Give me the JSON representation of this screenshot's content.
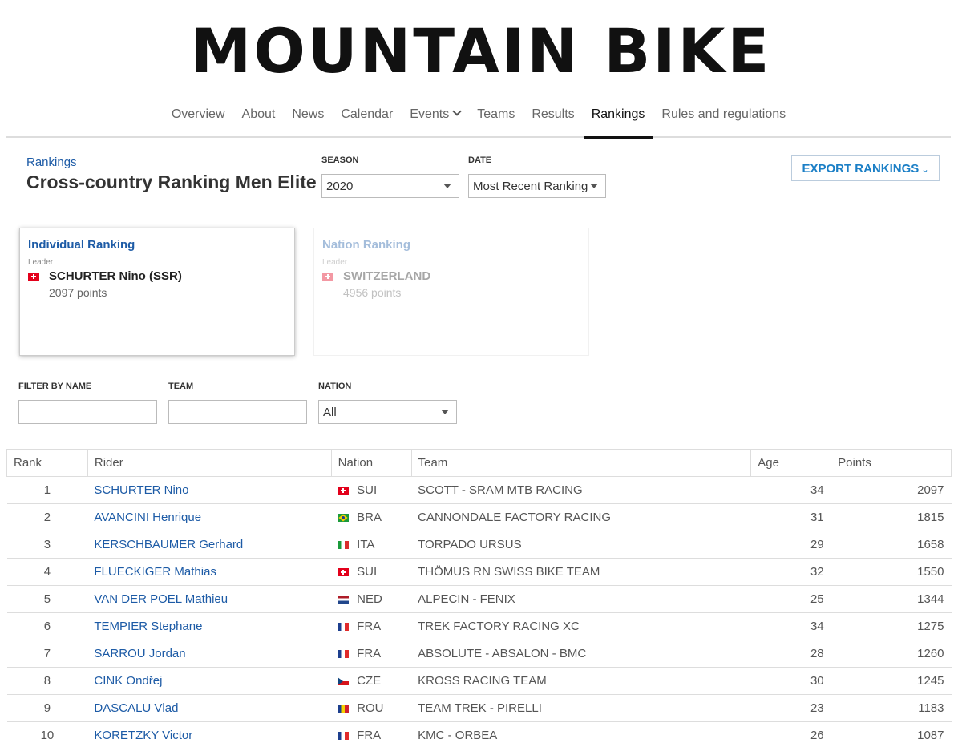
{
  "site": {
    "title": "MOUNTAIN BIKE"
  },
  "nav": {
    "items": [
      {
        "label": "Overview"
      },
      {
        "label": "About"
      },
      {
        "label": "News"
      },
      {
        "label": "Calendar"
      },
      {
        "label": "Events"
      },
      {
        "label": "Teams"
      },
      {
        "label": "Results"
      },
      {
        "label": "Rankings"
      },
      {
        "label": "Rules and regulations"
      }
    ],
    "active": "Rankings"
  },
  "header": {
    "breadcrumb": "Rankings",
    "title": "Cross-country Ranking Men Elite",
    "season_label": "SEASON",
    "season_value": "2020",
    "date_label": "DATE",
    "date_value": "Most Recent Ranking",
    "export_label": "EXPORT RANKINGS"
  },
  "cards": {
    "individual": {
      "title": "Individual Ranking",
      "sub": "Leader",
      "leader": "SCHURTER Nino (SSR)",
      "points": "2097 points",
      "flag": "ch"
    },
    "nation": {
      "title": "Nation Ranking",
      "sub": "Leader",
      "leader": "SWITZERLAND",
      "points": "4956 points",
      "flag": "ch"
    }
  },
  "filters": {
    "name_label": "FILTER BY NAME",
    "team_label": "TEAM",
    "nation_label": "NATION",
    "nation_value": "All"
  },
  "table": {
    "headers": [
      "Rank",
      "Rider",
      "Nation",
      "Team",
      "Age",
      "Points"
    ],
    "rows": [
      {
        "rank": "1",
        "rider": "SCHURTER Nino",
        "flag": "ch",
        "nation": "SUI",
        "team": "SCOTT - SRAM MTB RACING",
        "age": "34",
        "points": "2097"
      },
      {
        "rank": "2",
        "rider": "AVANCINI Henrique",
        "flag": "br",
        "nation": "BRA",
        "team": "CANNONDALE FACTORY RACING",
        "age": "31",
        "points": "1815"
      },
      {
        "rank": "3",
        "rider": "KERSCHBAUMER Gerhard",
        "flag": "it",
        "nation": "ITA",
        "team": "TORPADO URSUS",
        "age": "29",
        "points": "1658"
      },
      {
        "rank": "4",
        "rider": "FLUECKIGER Mathias",
        "flag": "ch",
        "nation": "SUI",
        "team": "THÖMUS RN SWISS BIKE TEAM",
        "age": "32",
        "points": "1550"
      },
      {
        "rank": "5",
        "rider": "VAN DER POEL Mathieu",
        "flag": "nl",
        "nation": "NED",
        "team": "ALPECIN - FENIX",
        "age": "25",
        "points": "1344"
      },
      {
        "rank": "6",
        "rider": "TEMPIER Stephane",
        "flag": "fr",
        "nation": "FRA",
        "team": "TREK FACTORY RACING XC",
        "age": "34",
        "points": "1275"
      },
      {
        "rank": "7",
        "rider": "SARROU Jordan",
        "flag": "fr",
        "nation": "FRA",
        "team": "ABSOLUTE - ABSALON - BMC",
        "age": "28",
        "points": "1260"
      },
      {
        "rank": "8",
        "rider": "CINK Ondřej",
        "flag": "cz",
        "nation": "CZE",
        "team": "KROSS RACING TEAM",
        "age": "30",
        "points": "1245"
      },
      {
        "rank": "9",
        "rider": "DASCALU Vlad",
        "flag": "ro",
        "nation": "ROU",
        "team": "TEAM TREK - PIRELLI",
        "age": "23",
        "points": "1183"
      },
      {
        "rank": "10",
        "rider": "KORETZKY Victor",
        "flag": "fr",
        "nation": "FRA",
        "team": "KMC - ORBEA",
        "age": "26",
        "points": "1087"
      }
    ]
  }
}
